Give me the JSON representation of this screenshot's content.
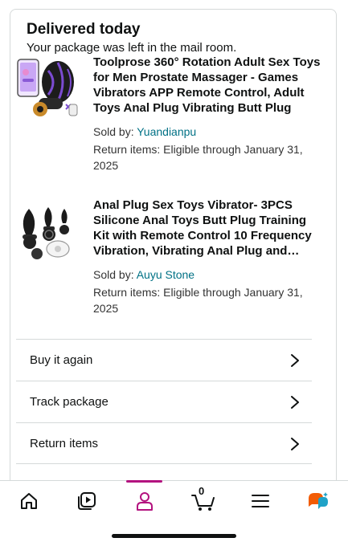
{
  "order": {
    "status_title": "Delivered today",
    "status_subtitle": "Your package was left in the mail room."
  },
  "items": [
    {
      "title": "Toolprose 360° Rotation Adult Sex Toys for Men Prostate Massager - Games Vibrators APP Remote Control, Adult Toys Anal Plug Vibrating Butt Plug",
      "sold_by_label": "Sold by: ",
      "seller": "Yuandianpu",
      "return_text": "Return items: Eligible through January 31, 2025"
    },
    {
      "title": "Anal Plug Sex Toys Vibrator- 3PCS Silicone Anal Toys Butt Plug Training Kit with Remote Control 10 Frequency Vibration, Vibrating Anal Plug and Remote",
      "sold_by_label": "Sold by: ",
      "seller": "Auyu Stone",
      "return_text": "Return items: Eligible through January 31, 2025"
    }
  ],
  "actions": {
    "buy_again": "Buy it again",
    "track_package": "Track package",
    "return_items": "Return items"
  },
  "nav": {
    "cart_count": "0",
    "active_tab": "account",
    "accent_color": "#b3137f",
    "link_color": "#007185"
  }
}
